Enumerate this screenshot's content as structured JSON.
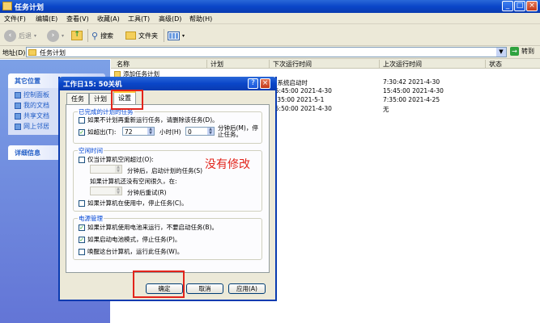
{
  "window": {
    "title": "任务计划"
  },
  "menu": [
    "文件(F)",
    "编辑(E)",
    "查看(V)",
    "收藏(A)",
    "工具(T)",
    "高级(D)",
    "帮助(H)"
  ],
  "toolbar": {
    "back": "后退",
    "search": "搜索",
    "folders": "文件夹"
  },
  "address": {
    "label": "地址(D)",
    "value": "任务计划",
    "go": "转到"
  },
  "sidebar": {
    "other_places": {
      "title": "其它位置",
      "items": [
        "控制面板",
        "我的文档",
        "共享文档",
        "网上邻居"
      ]
    },
    "details": {
      "title": "详细信息"
    }
  },
  "list": {
    "headers": [
      "名称",
      "计划",
      "下次运行时间",
      "上次运行时间",
      "状态"
    ],
    "rows": [
      {
        "name": "添加任务计划",
        "schedule": "",
        "next": "",
        "last": ""
      },
      {
        "name": "",
        "schedule": "",
        "next": "在系统启动时",
        "last": "7:30:42  2021-4-30"
      },
      {
        "name": "",
        "schedule": "",
        "next": "15:45:00  2021-4-30",
        "last": "15:45:00  2021-4-30"
      },
      {
        "name": "",
        "schedule": "",
        "next": "7:35:00  2021-5-1",
        "last": "7:35:00  2021-4-25"
      },
      {
        "name": "",
        "schedule": "",
        "next": "15:50:00  2021-4-30",
        "last": "无"
      }
    ]
  },
  "dialog": {
    "title": "工作日15: 50关机",
    "tabs": [
      "任务",
      "计划",
      "设置"
    ],
    "group_completed": {
      "title": "已完成的计划的任务",
      "delete_label": "如果不计划再重新运行任务，请删除该任务(D)。",
      "stop_label": "如超出(T):",
      "stop_value": "72",
      "hours_label": "小时(H)",
      "minutes_value": "0",
      "minutes_label": "分钟后(M)，停止任务。"
    },
    "group_idle": {
      "title": "空闲时间",
      "only_idle_label": "仅当计算机空闲超过(O):",
      "after_label": "分钟后，启动计划的任务(S)",
      "not_idle_label": "如果计算机还没有空闲很久，在:",
      "retry_label": "分钟后重试(R)",
      "stop_if_busy_label": "如果计算机在使用中，停止任务(C)。"
    },
    "group_power": {
      "title": "电源管理",
      "battery_label": "如果计算机使用电池来运行，不要启动任务(B)。",
      "battery_stop_label": "如果启动电池模式，停止任务(P)。",
      "wake_label": "唤醒这台计算机，运行此任务(W)。"
    },
    "buttons": {
      "ok": "确定",
      "cancel": "取消",
      "apply": "应用(A)"
    }
  },
  "annotation": {
    "text": "没有修改",
    "color": "#e2241b"
  }
}
